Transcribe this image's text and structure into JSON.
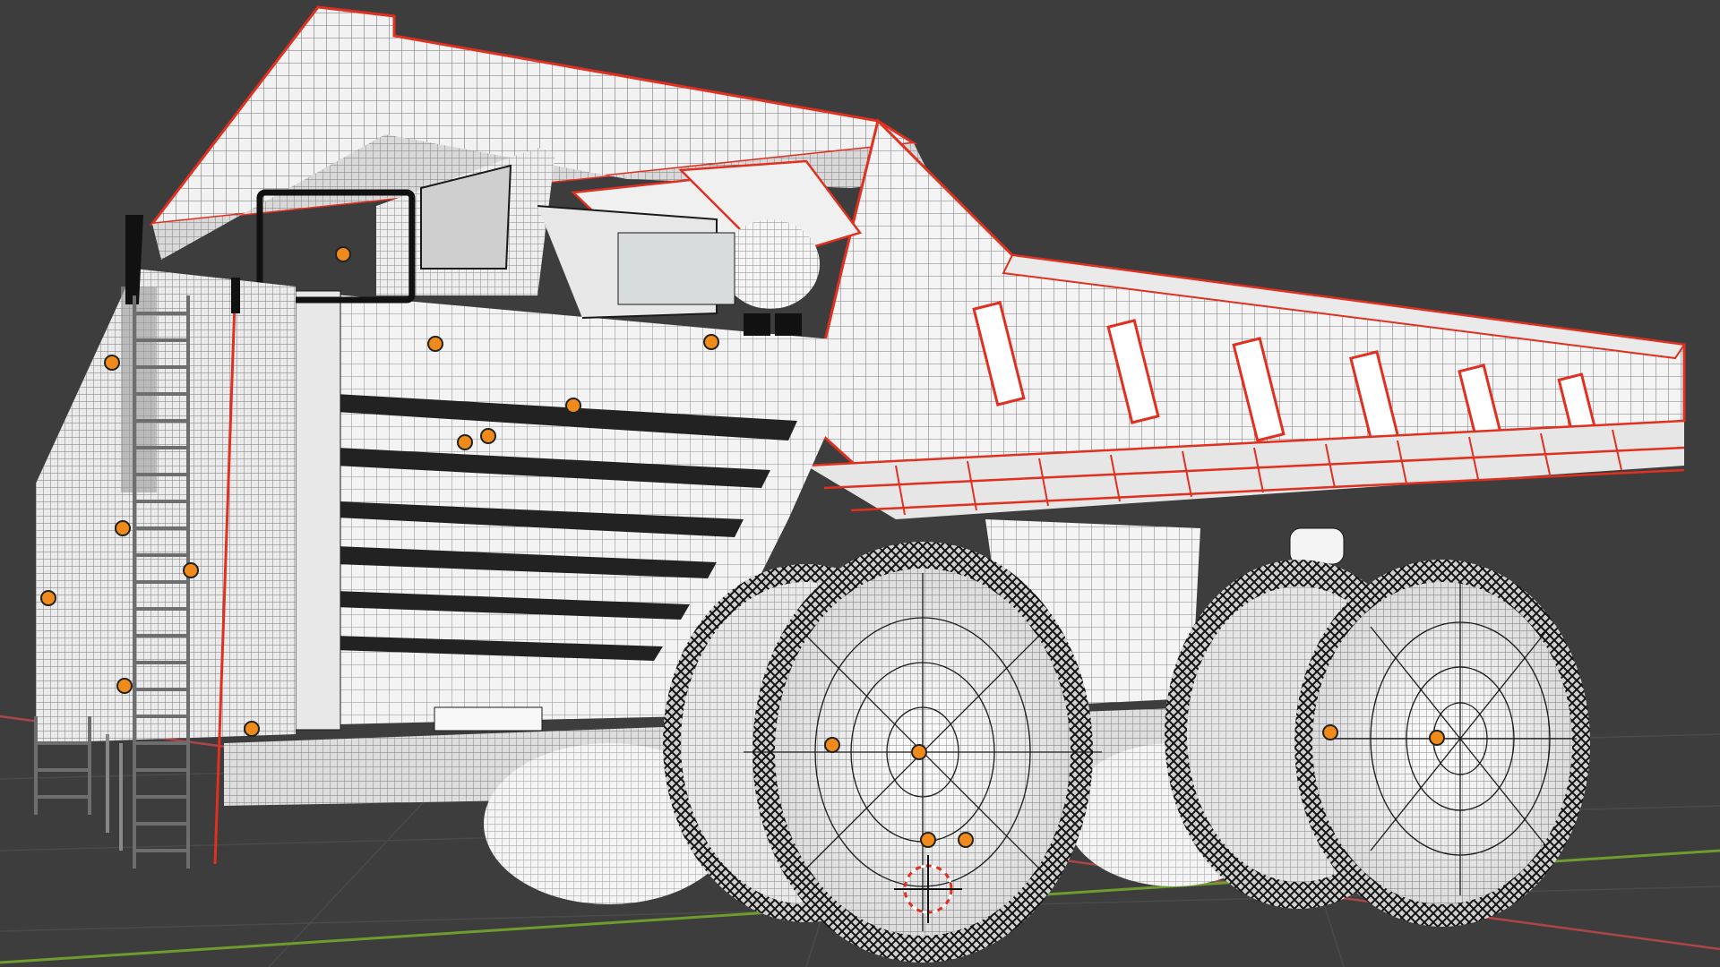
{
  "viewport": {
    "background": "#3d3d3d",
    "grid_color": "#4a4a4a",
    "x_axis_color": "#c8474b",
    "y_axis_color": "#6f9c2e"
  },
  "model": {
    "object": "haul-truck",
    "display_mode": "wireframe-on-shaded",
    "body_color": "#f2f2f2",
    "shadow_color": "#8f9a9a",
    "wire_color": "#1a1a1a",
    "selected_edge_color": "#e03020",
    "origin_color": "#f08a1a"
  },
  "cursor_3d": {
    "icon": "3d-cursor-icon"
  }
}
